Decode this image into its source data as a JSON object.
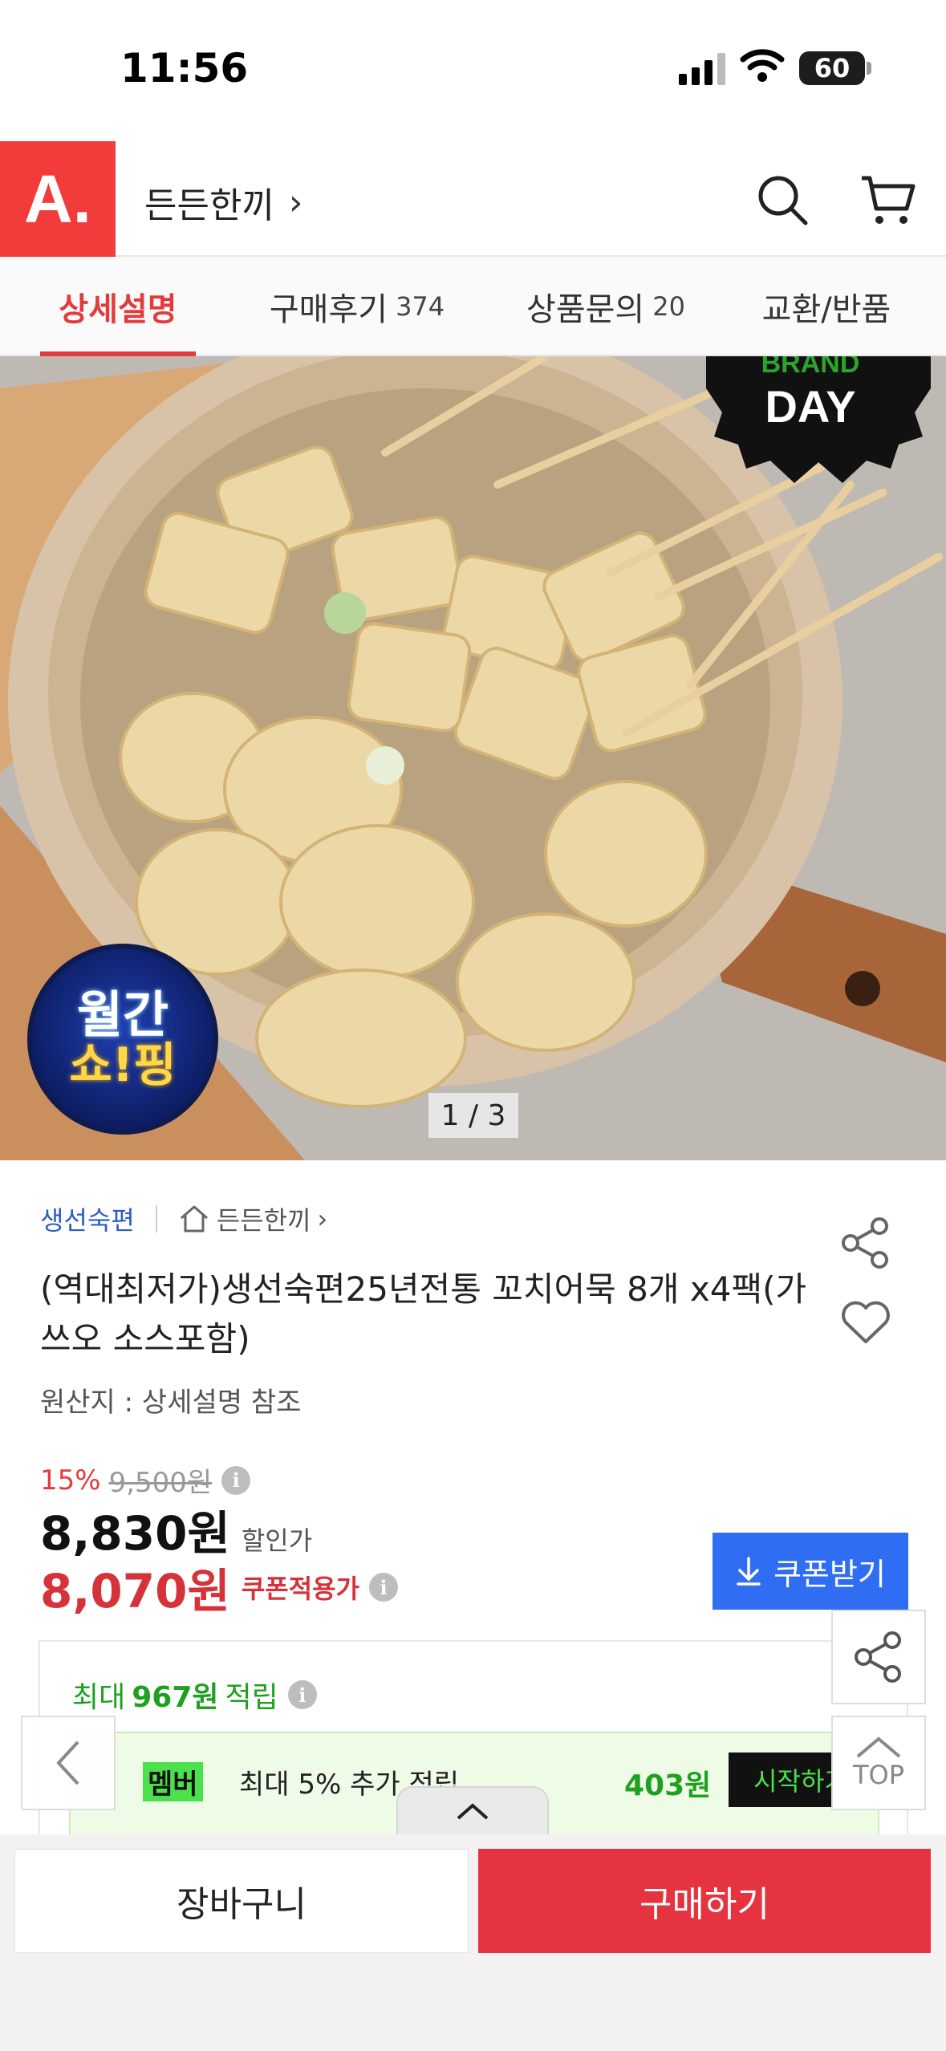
{
  "status_bar": {
    "time": "11:56",
    "battery": "60"
  },
  "header": {
    "logo_text": "A.",
    "store_name": "든든한끼",
    "chevron": "›"
  },
  "tabs": [
    {
      "label": "상세설명",
      "count": ""
    },
    {
      "label": "구매후기",
      "count": "374"
    },
    {
      "label": "상품문의",
      "count": "20"
    },
    {
      "label": "교환/반품",
      "count": ""
    }
  ],
  "hero": {
    "page_indicator": "1 / 3",
    "brand_day_text": "DAY",
    "badge_line1": "월간",
    "badge_line2": "쇼!핑"
  },
  "product": {
    "seller": "생선숙편",
    "store_link": "든든한끼",
    "store_link_chevron": "›",
    "title": "(역대최저가)생선숙편25년전통 꼬치어묵 8개 x4팩(가쓰오 소스포함)",
    "origin": "원산지 : 상세설명 참조",
    "discount_rate": "15%",
    "original_price": "9,500원",
    "sale_price": "8,830원",
    "sale_label": "할인가",
    "coupon_price": "8,070원",
    "coupon_label": "쿠폰적용가",
    "coupon_button": "쿠폰받기",
    "info_symbol": "i"
  },
  "points": {
    "prefix": "최대",
    "amount": "967원",
    "suffix": "적립",
    "member_tag": "멤버",
    "member_text": "최대 5% 추가 적립",
    "member_points": "403원",
    "member_button": "시작하기"
  },
  "floating": {
    "top_label": "TOP"
  },
  "bottom_bar": {
    "cart_label": "장바구니",
    "buy_label": "구매하기"
  },
  "colors": {
    "accent_red": "#e5343f",
    "logo_red": "#f23b3b",
    "coupon_blue": "#2f6ef2",
    "point_green": "#20a020"
  }
}
